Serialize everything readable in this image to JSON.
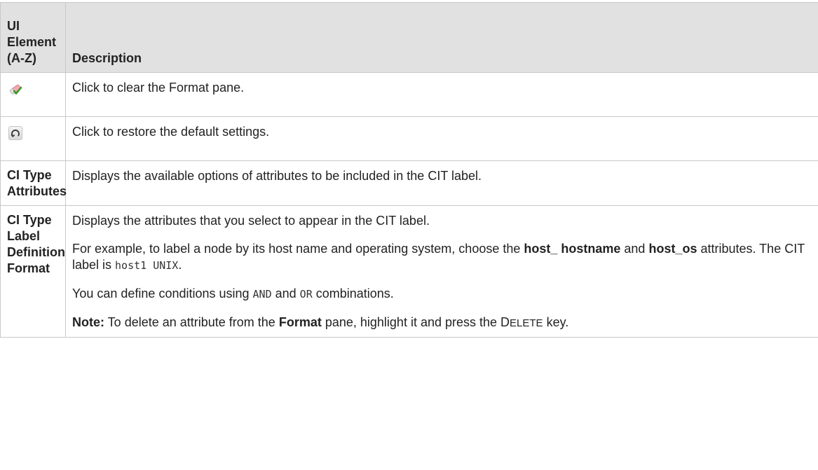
{
  "table": {
    "header": {
      "col1": [
        "UI",
        "Element",
        "(A-Z)"
      ],
      "col2": "Description"
    },
    "rows": [
      {
        "icon": "clear-format-icon",
        "description": "Click to clear the Format pane."
      },
      {
        "icon": "restore-default-icon",
        "description": "Click to restore the default settings."
      },
      {
        "name": [
          "CI Type",
          "Attributes"
        ],
        "description": "Displays the available options of attributes to be included in the CIT label."
      },
      {
        "name": [
          "CI Type",
          "Label",
          "Definition",
          "Format"
        ],
        "p1": "Displays the attributes that you select to appear in the CIT label.",
        "p2": {
          "a": "For example, to label a node by its host name and operating system, choose the ",
          "b1": "host_ hostname",
          "c": " and ",
          "b2": "host_os",
          "d": " attributes. The CIT label is ",
          "code": "host1 UNIX",
          "e": "."
        },
        "p3": {
          "a": "You can define conditions using ",
          "and": "AND",
          "b": " and ",
          "or": "OR",
          "c": " combinations."
        },
        "p4": {
          "note": "Note:",
          "a": " To delete an attribute from the ",
          "format": "Format",
          "b": " pane, highlight it and press the ",
          "key_first": "D",
          "key_rest": "ELETE",
          "c": " key."
        }
      }
    ]
  }
}
